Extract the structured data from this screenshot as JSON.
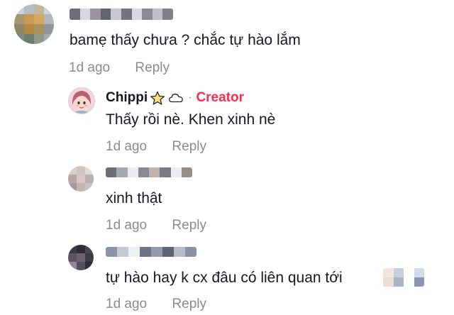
{
  "comments": [
    {
      "text": "bamẹ thấy chưa ? chắc tự hào lắm",
      "time": "1d ago",
      "reply_label": "Reply",
      "username_blurred": true
    },
    {
      "username": "Chippi",
      "badge_icon": "star-outline-icon",
      "cloud_icon": "cloud-outline-icon",
      "separator": "·",
      "creator_label": "Creator",
      "creator_color": "#fe2c55",
      "text": "Thấy rồi nè. Khen xinh nè",
      "time": "1d ago",
      "reply_label": "Reply"
    },
    {
      "text": "xinh thật",
      "time": "1d ago",
      "reply_label": "Reply",
      "username_blurred": true
    },
    {
      "text": "tự hào hay k cx đâu có liên quan tới",
      "time": "1d ago",
      "reply_label": "Reply",
      "username_blurred": true
    }
  ]
}
